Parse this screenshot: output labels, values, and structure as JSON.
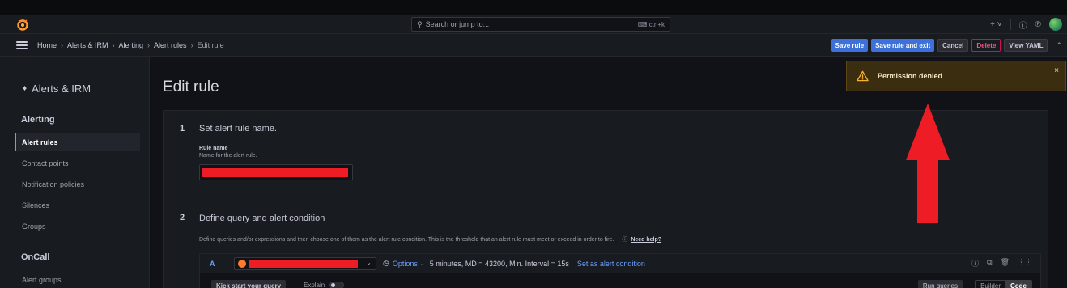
{
  "header": {
    "search_placeholder": "Search or jump to...",
    "search_shortcut": "ctrl+k",
    "plus_label": "+ ˅"
  },
  "breadcrumb": [
    "Home",
    "Alerts & IRM",
    "Alerting",
    "Alert rules",
    "Edit rule"
  ],
  "toolbar": {
    "save_rule": "Save rule",
    "save_exit": "Save rule and exit",
    "cancel": "Cancel",
    "delete": "Delete",
    "view_yaml": "View YAML"
  },
  "sidebar": {
    "title": "Alerts & IRM",
    "section_alerting": "Alerting",
    "items": [
      "Alert rules",
      "Contact points",
      "Notification policies",
      "Silences",
      "Groups"
    ],
    "section_oncall": "OnCall",
    "oncall_items": [
      "Alert groups"
    ]
  },
  "main": {
    "title": "Edit rule",
    "step1": {
      "number": "1",
      "title": "Set alert rule name.",
      "field_label": "Rule name",
      "field_desc": "Name for the alert rule."
    },
    "step2": {
      "number": "2",
      "title": "Define query and alert condition",
      "desc": "Define queries and/or expressions and then choose one of them as the alert rule condition. This is the threshold that an alert rule must meet or exceed in order to fire.",
      "help_link": "Need help?"
    },
    "query": {
      "ref": "A",
      "options_label": "Options",
      "options_summary": "5 minutes, MD = 43200, Min. Interval = 15s",
      "set_condition": "Set as alert condition",
      "kick_start": "Kick start your query",
      "explain": "Explain",
      "run_queries": "Run queries",
      "builder": "Builder",
      "code": "Code"
    }
  },
  "toast": {
    "message": "Permission denied"
  },
  "colors": {
    "primary": "#3d71d9",
    "danger": "#d10e5c",
    "warning_bg": "#3b2e10",
    "annotation_arrow": "#ee1c24",
    "accent_orange": "#ff7a2b"
  }
}
